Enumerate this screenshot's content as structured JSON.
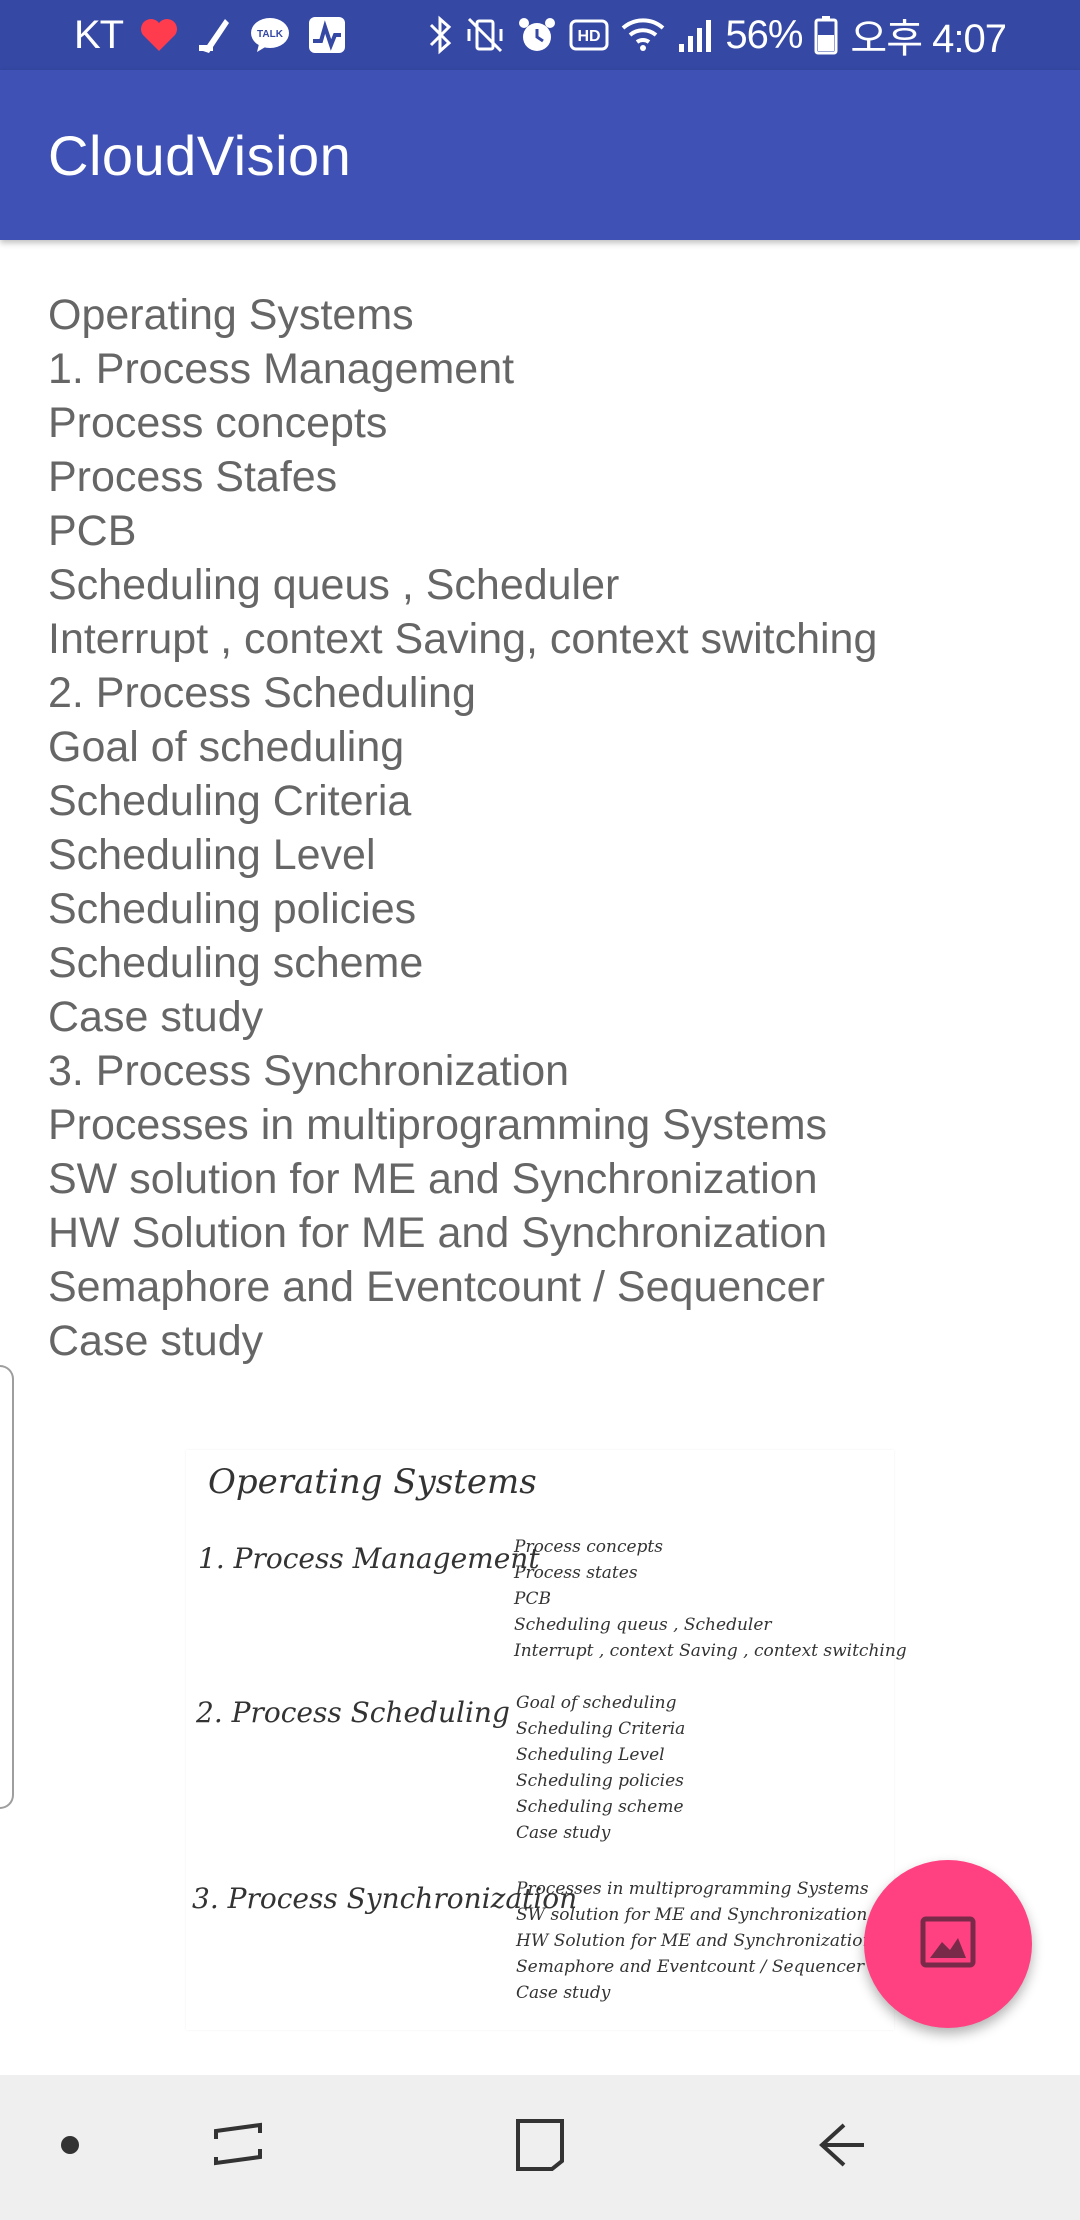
{
  "status_bar": {
    "carrier": "KT",
    "kakao_label": "TALK",
    "battery": "56%",
    "time": "오후 4:07",
    "hd_label": "HD",
    "icons": [
      "heart-icon",
      "cheer-icon",
      "kakaotalk-icon",
      "activity-icon",
      "bluetooth-icon",
      "vibrate-mute-icon",
      "alarm-icon",
      "hd-voice-icon",
      "wifi-icon",
      "signal-icon",
      "battery-icon"
    ]
  },
  "app_bar": {
    "title": "CloudVision"
  },
  "ocr_result": {
    "lines": [
      "Operating Systems",
      "1. Process Management",
      "Process concepts",
      "Process Stafes",
      "PCB",
      "Scheduling queus , Scheduler",
      "Interrupt , context Saving, context switching",
      "2. Process Scheduling",
      "Goal of scheduling",
      "Scheduling Criteria",
      "Scheduling Level",
      "Scheduling policies",
      "Scheduling scheme",
      "Case study",
      "3. Process Synchronization",
      "Processes in multiprogramming Systems",
      "SW solution for ME and Synchronization",
      "HW Solution for ME and Synchronization",
      "Semaphore and Eventcount / Sequencer",
      "Case study"
    ]
  },
  "note_image": {
    "title": "Operating Systems",
    "sections": [
      {
        "heading": "1. Process Management",
        "items": [
          "Process concepts",
          "Process states",
          "PCB",
          "Scheduling queus , Scheduler",
          "Interrupt , context Saving , context switching"
        ]
      },
      {
        "heading": "2. Process Scheduling",
        "items": [
          "Goal of scheduling",
          "Scheduling Criteria",
          "Scheduling Level",
          "Scheduling policies",
          "Scheduling scheme",
          "Case study"
        ]
      },
      {
        "heading": "3. Process Synchronization",
        "items": [
          "Processes in multiprogramming Systems",
          "SW solution for ME and Synchronization",
          "HW Solution for ME and Synchronization",
          "Semaphore and Eventcount / Sequencer",
          "Case study"
        ]
      }
    ]
  },
  "fab": {
    "icon": "image-icon",
    "color": "#ff4081"
  },
  "nav_bar": {
    "buttons": [
      "nav-dot",
      "recent-apps",
      "home",
      "back"
    ]
  },
  "colors": {
    "primary": "#3f51b5",
    "primary_dark": "#3548a4",
    "accent": "#ff4081",
    "text": "#666666"
  }
}
